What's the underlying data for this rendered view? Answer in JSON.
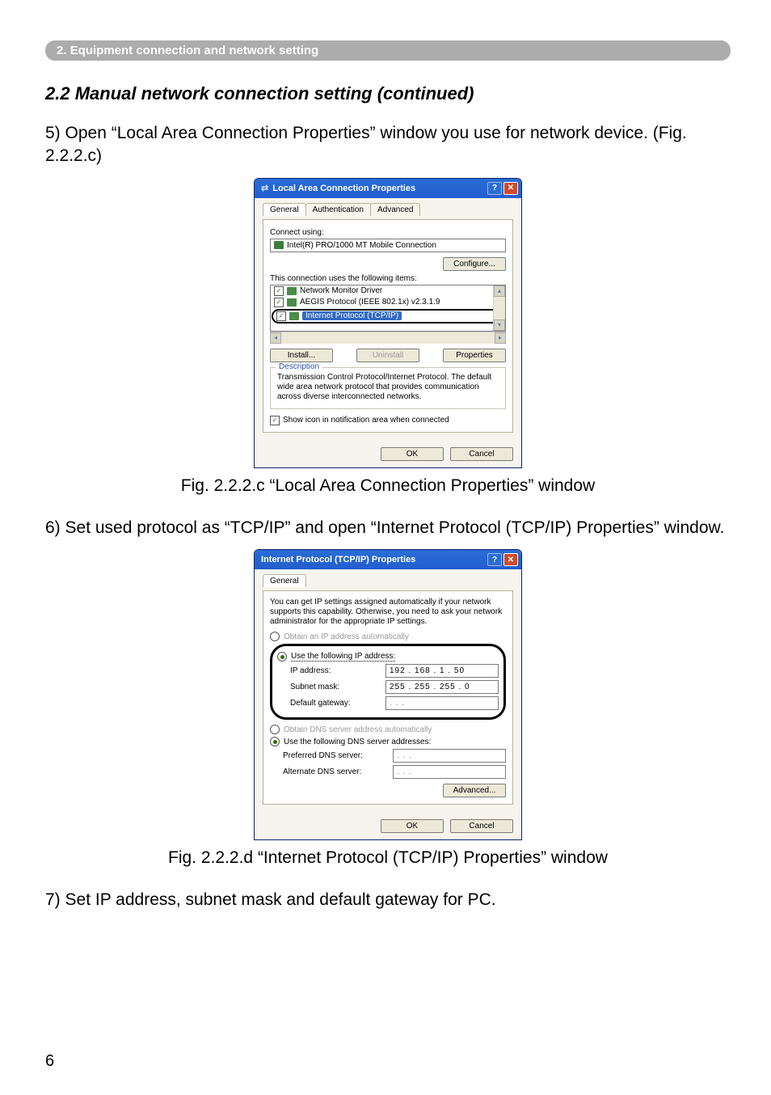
{
  "sectionBar": "2. Equipment connection and network setting",
  "heading": "2.2 Manual network connection setting (continued)",
  "step5": "5) Open “Local Area Connection Properties” window you use for network device. (Fig. 2.2.2.c)",
  "dialog1": {
    "title": "Local Area Connection Properties",
    "tabs": [
      "General",
      "Authentication",
      "Advanced"
    ],
    "connectUsingLabel": "Connect using:",
    "adapter": "Intel(R) PRO/1000 MT Mobile Connection",
    "configureBtn": "Configure...",
    "itemsLabel": "This connection uses the following items:",
    "items": [
      {
        "label": "Network Monitor Driver"
      },
      {
        "label": "AEGIS Protocol (IEEE 802.1x) v2.3.1.9"
      },
      {
        "label": "Internet Protocol (TCP/IP)"
      }
    ],
    "installBtn": "Install...",
    "uninstallBtn": "Uninstall",
    "propertiesBtn": "Properties",
    "descLegend": "Description",
    "descText": "Transmission Control Protocol/Internet Protocol. The default wide area network protocol that provides communication across diverse interconnected networks.",
    "showIcon": "Show icon in notification area when connected",
    "ok": "OK",
    "cancel": "Cancel"
  },
  "caption1": "Fig. 2.2.2.c “Local Area Connection Properties” window",
  "step6": "6) Set used protocol as “TCP/IP” and open “Internet Protocol (TCP/IP) Properties” window.",
  "dialog2": {
    "title": "Internet Protocol (TCP/IP) Properties",
    "tab": "General",
    "intro": "You can get IP settings assigned automatically if your network supports this capability. Otherwise, you need to ask your network administrator for the appropriate IP settings.",
    "radioAuto": "Obtain an IP address automatically",
    "radioManual": "Use the following IP address:",
    "ipLabel": "IP address:",
    "ipValue": "192 . 168 .   1  .  50",
    "subnetLabel": "Subnet mask:",
    "subnetValue": "255 . 255 . 255 .   0",
    "gatewayLabel": "Default gateway:",
    "gatewayValue": "    .       .       .",
    "radioDnsAuto": "Obtain DNS server address automatically",
    "radioDnsManual": "Use the following DNS server addresses:",
    "prefDnsLabel": "Preferred DNS server:",
    "prefDnsValue": "    .       .       .",
    "altDnsLabel": "Alternate DNS server:",
    "altDnsValue": "    .       .       .",
    "advanced": "Advanced...",
    "ok": "OK",
    "cancel": "Cancel"
  },
  "caption2": "Fig. 2.2.2.d “Internet Protocol (TCP/IP) Properties” window",
  "step7": "7) Set IP address, subnet mask and default gateway for PC.",
  "pageNum": "6"
}
